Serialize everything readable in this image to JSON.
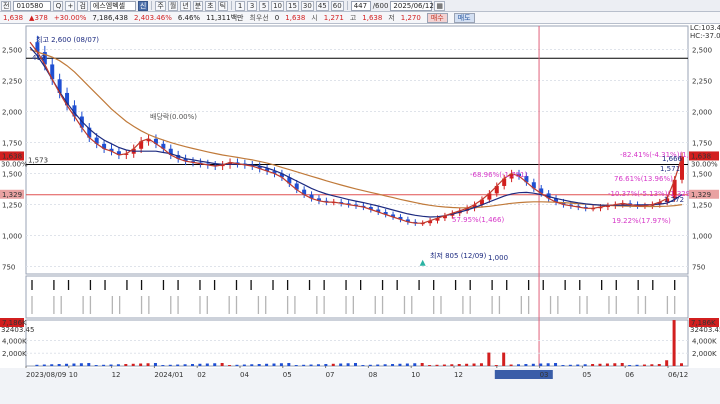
{
  "toolbar": {
    "code_prefix": "전",
    "stock_code": "010580",
    "search_glyph": "Q",
    "name_glyph": "+",
    "name_hint": "검",
    "stock_name": "에스엠벡셀",
    "info_glyph": "신",
    "period_buttons": [
      "주",
      "월",
      "년",
      "분",
      "초",
      "틱"
    ],
    "period_active_index": -1,
    "minute_buttons": [
      "1",
      "3",
      "5",
      "10",
      "15",
      "30",
      "45",
      "60"
    ],
    "count_value": "447",
    "count_total": "/600",
    "date_value": "2025/06/12",
    "calendar_glyph": "▦"
  },
  "quote": {
    "price": "1,638",
    "change": "378",
    "change_pct": "+30.00%",
    "volume": "7,186,438",
    "volume_pct": "2,403.46%",
    "turnover_rate": "6.46%",
    "amount": "11,311백만",
    "pref_label": "최우선",
    "pref_value": "0",
    "last_value": "1,638",
    "open_label": "시",
    "open_value": "1,271",
    "high_label": "고",
    "high_value": "1,638",
    "low_label": "저",
    "low_value": "1,270",
    "buy_label": "매수",
    "sell_label": "매도"
  },
  "colors": {
    "up": "#d21f1f",
    "down": "#1f4fd2",
    "ma5": "#c0392b",
    "ma20": "#1d2b80",
    "ma60": "#2e8b57",
    "ma120": "#c07a3a",
    "highlight_pink": "#d637c8"
  },
  "chart_data": {
    "type": "candlestick",
    "x_dates": [
      "2023/08/09",
      "2023/08",
      "2023/10",
      "2023/12",
      "2024/01",
      "2024/02",
      "2024/04",
      "2024/05",
      "2024/07",
      "2024/08",
      "2024/10",
      "2024/12",
      "2025/01/23",
      "2025/03",
      "2025/05",
      "2025/06"
    ],
    "x_tick_labels": [
      "2023/08/09",
      "10",
      "12",
      "2024/01",
      "02",
      "04",
      "05",
      "07",
      "08",
      "10",
      "12",
      "2025/01/23(목)",
      "03",
      "05",
      "06",
      "06/12"
    ],
    "price_axis_ticks": [
      750,
      1000,
      1250,
      1500,
      1750,
      2000,
      2250,
      2500
    ],
    "price_axis_labels": [
      "750",
      "1,000",
      "1,250",
      "1,500",
      "1,750",
      "2,000",
      "2,250",
      "2,500"
    ],
    "price_ylim": [
      690,
      2690
    ],
    "volume_axis_ticks": [
      2000000,
      4000000
    ],
    "volume_axis_labels": [
      "2,000K",
      "4,000K"
    ],
    "volume_ylim": [
      0,
      7200000
    ],
    "right_badges": {
      "last_price": "1,638",
      "last_price_pct": "30.00%",
      "ref_price": "1,329",
      "volume_max": "7,186K",
      "volume_pct": "32403.45"
    },
    "left_badges": {
      "last_price": "1,638",
      "last_price_pct": "30.00%",
      "ref_price": "1,329",
      "volume_max": "7,186K",
      "volume_pct": "32403.45"
    },
    "top_right_labels": [
      "LC:103.45",
      "HC:-37.00"
    ],
    "horizontal_lines": [
      {
        "price": 2430,
        "color": "#000000"
      },
      {
        "price": 1573,
        "color": "#000000",
        "label": "1,573"
      },
      {
        "price": 1329,
        "color": "#e05050"
      }
    ],
    "vertical_marker_date": "2025/01/23",
    "annotations": [
      {
        "text": "최고 2,600 (08/07)",
        "color": "#1d2b80"
      },
      {
        "text": "419",
        "color": "#1d2b80"
      },
      {
        "text": "배당락(0.00%)",
        "color": "#555555"
      },
      {
        "text": "최저 805 (12/09)",
        "color": "#1d2b80"
      },
      {
        "text": "-68.96%(-1,791)",
        "color": "#d637c8"
      },
      {
        "text": "57.95%(1,466)",
        "color": "#d637c8"
      },
      {
        "text": "-82.41%(-4.31%)(1,641)",
        "color": "#d637c8"
      },
      {
        "text": "76.61%(13.96%)",
        "color": "#d637c8"
      },
      {
        "text": "-10.37%(-5.13%)(1,329)",
        "color": "#d637c8"
      },
      {
        "text": "19.22%(17.97%)",
        "color": "#d637c8"
      },
      {
        "text": "1,571",
        "color": "#1d2b80"
      },
      {
        "text": "1,666",
        "color": "#1d2b80"
      },
      {
        "text": "1,272",
        "color": "#1d2b80"
      },
      {
        "text": "1,000",
        "color": "#1d2b80"
      }
    ],
    "price_close_series": [
      2560,
      2480,
      2380,
      2260,
      2150,
      2050,
      1960,
      1870,
      1790,
      1740,
      1700,
      1680,
      1650,
      1660,
      1700,
      1760,
      1780,
      1740,
      1700,
      1650,
      1620,
      1600,
      1590,
      1580,
      1570,
      1560,
      1570,
      1590,
      1580,
      1570,
      1560,
      1540,
      1520,
      1500,
      1470,
      1420,
      1370,
      1330,
      1300,
      1280,
      1270,
      1270,
      1260,
      1250,
      1240,
      1230,
      1210,
      1190,
      1170,
      1150,
      1130,
      1110,
      1100,
      1100,
      1120,
      1140,
      1160,
      1180,
      1200,
      1220,
      1250,
      1290,
      1340,
      1400,
      1460,
      1500,
      1480,
      1430,
      1380,
      1340,
      1300,
      1270,
      1250,
      1240,
      1230,
      1220,
      1220,
      1230,
      1240,
      1250,
      1260,
      1250,
      1240,
      1240,
      1250,
      1270,
      1300,
      1450,
      1638
    ],
    "ma20_series": [
      2520,
      2450,
      2360,
      2260,
      2160,
      2070,
      1990,
      1920,
      1860,
      1810,
      1770,
      1740,
      1710,
      1690,
      1680,
      1680,
      1680,
      1680,
      1670,
      1660,
      1640,
      1620,
      1610,
      1600,
      1590,
      1580,
      1575,
      1575,
      1575,
      1575,
      1570,
      1560,
      1545,
      1525,
      1500,
      1470,
      1440,
      1410,
      1380,
      1355,
      1335,
      1320,
      1305,
      1290,
      1278,
      1266,
      1252,
      1238,
      1222,
      1206,
      1190,
      1175,
      1163,
      1155,
      1150,
      1152,
      1160,
      1172,
      1188,
      1206,
      1226,
      1248,
      1272,
      1296,
      1318,
      1336,
      1346,
      1348,
      1342,
      1330,
      1315,
      1300,
      1286,
      1274,
      1264,
      1256,
      1250,
      1246,
      1244,
      1244,
      1245,
      1246,
      1247,
      1248,
      1250,
      1254,
      1262,
      1290,
      1330
    ],
    "ma120_series": [
      2500,
      2480,
      2460,
      2440,
      2410,
      2370,
      2320,
      2260,
      2200,
      2140,
      2080,
      2020,
      1970,
      1920,
      1880,
      1845,
      1815,
      1790,
      1770,
      1750,
      1733,
      1717,
      1702,
      1688,
      1675,
      1662,
      1650,
      1640,
      1630,
      1620,
      1610,
      1598,
      1584,
      1568,
      1550,
      1532,
      1514,
      1496,
      1478,
      1460,
      1442,
      1425,
      1408,
      1392,
      1376,
      1362,
      1348,
      1334,
      1320,
      1306,
      1292,
      1279,
      1266,
      1254,
      1244,
      1236,
      1230,
      1226,
      1224,
      1224,
      1226,
      1230,
      1236,
      1244,
      1252,
      1260,
      1266,
      1270,
      1272,
      1272,
      1271,
      1269,
      1266,
      1262,
      1258,
      1254,
      1250,
      1246,
      1243,
      1240,
      1238,
      1236,
      1235,
      1234,
      1234,
      1235,
      1237,
      1242,
      1250
    ]
  }
}
